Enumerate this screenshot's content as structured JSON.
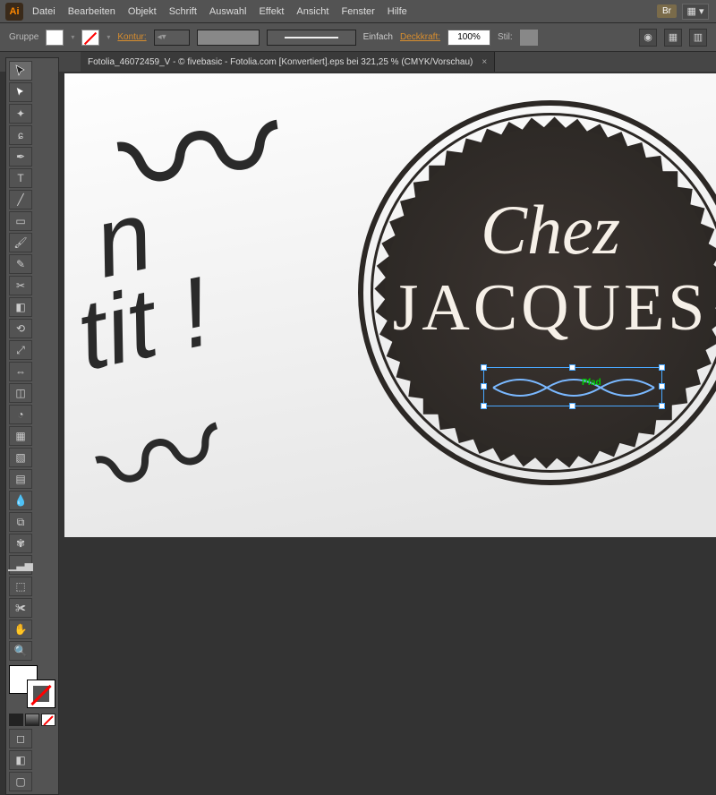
{
  "app": {
    "logo": "Ai"
  },
  "menu": {
    "items": [
      "Datei",
      "Bearbeiten",
      "Objekt",
      "Schrift",
      "Auswahl",
      "Effekt",
      "Ansicht",
      "Fenster",
      "Hilfe"
    ],
    "bridge": "Br"
  },
  "options": {
    "group_label": "Gruppe",
    "kontur_label": "Kontur:",
    "stroke_style": "Einfach",
    "deckkraft_label": "Deckkraft:",
    "deckkraft_value": "100%",
    "stil_label": "Stil:"
  },
  "tab": {
    "title": "Fotolia_46072459_V - © fivebasic - Fotolia.com [Konvertiert].eps bei 321,25 % (CMYK/Vorschau)"
  },
  "artwork": {
    "italic_fragment": "n\n tit !",
    "chez": "Chez",
    "jacques": "JACQUES",
    "path_hint": "Pfad"
  }
}
